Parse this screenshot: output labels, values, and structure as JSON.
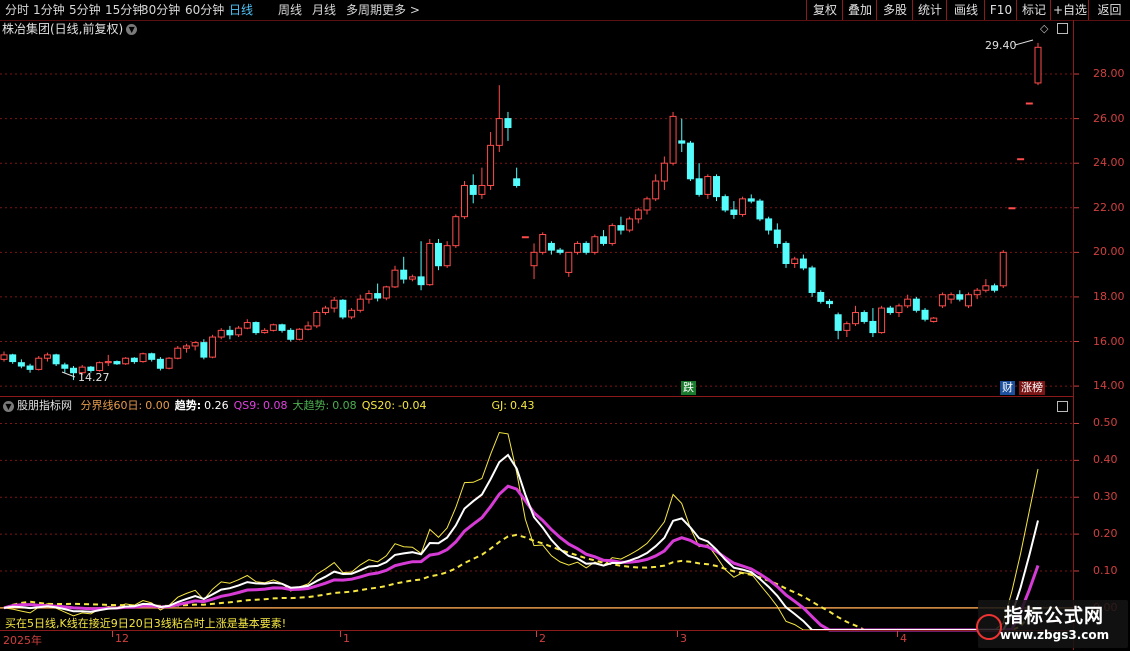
{
  "toolbar": {
    "periods": [
      "分时",
      "1分钟",
      "5分钟",
      "15分钟",
      "30分钟",
      "60分钟",
      "日线",
      "周线",
      "月线",
      "多周期",
      "更多"
    ],
    "active_period": "日线",
    "more_chevron": ">",
    "right_buttons": [
      "复权",
      "叠加",
      "多股",
      "统计",
      "画线",
      "F10",
      "标记",
      "+自选",
      "返回"
    ]
  },
  "stock": {
    "title": "株冶集团(日线,前复权)",
    "dropdown_icon": "chevron-down-icon"
  },
  "price_axis": {
    "labels": [
      "28.00",
      "26.00",
      "24.00",
      "22.00",
      "20.00",
      "18.00",
      "16.00",
      "14.00"
    ],
    "range": [
      13.6,
      30.2
    ]
  },
  "annotations": {
    "high_label": "29.40",
    "low_label": "14.27",
    "badge_die": "跌",
    "badge_cai": "财",
    "badge_zhangting": "涨榜"
  },
  "indicator": {
    "name": "股朋指标网",
    "items": [
      {
        "label": "分界线60日:",
        "value": "0.00",
        "color": "#e69a4c"
      },
      {
        "label": "趋势:",
        "value": "0.26",
        "color": "#ffffff"
      },
      {
        "label": "QS9:",
        "value": "0.08",
        "color": "#e040e0"
      },
      {
        "label": "大趋势:",
        "value": "0.08",
        "color": "#4caf50"
      },
      {
        "label": "QS20:",
        "value": "-0.04",
        "color": "#f5e642"
      },
      {
        "label": "GJ:",
        "value": "0.43",
        "color": "#f5e642"
      }
    ],
    "axis_labels": [
      "0.50",
      "0.40",
      "0.30",
      "0.20",
      "0.10",
      "0.00"
    ],
    "range": [
      -0.06,
      0.55
    ]
  },
  "bottom_note": "买在5日线,K线在接近9日20日3线粘合时上涨是基本要素!",
  "time_axis": {
    "labels": [
      "2025年",
      "12",
      "1",
      "2",
      "3",
      "4"
    ]
  },
  "watermark": {
    "title": "指标公式网",
    "url": "www.zbgs3.com"
  },
  "colors": {
    "up": "#ff4c4c",
    "down": "#54fcfc",
    "grid": "#7a1515",
    "axis": "#d04040"
  },
  "candles": [
    [
      15.2,
      15.55,
      15.1,
      15.4
    ],
    [
      15.4,
      15.45,
      15.0,
      15.1
    ],
    [
      15.05,
      15.2,
      14.8,
      14.9
    ],
    [
      14.9,
      15.0,
      14.6,
      14.75
    ],
    [
      14.75,
      15.35,
      14.7,
      15.25
    ],
    [
      15.25,
      15.5,
      15.1,
      15.4
    ],
    [
      15.4,
      15.45,
      14.9,
      15.0
    ],
    [
      14.95,
      15.05,
      14.6,
      14.8
    ],
    [
      14.8,
      14.9,
      14.27,
      14.6
    ],
    [
      14.6,
      14.95,
      14.5,
      14.85
    ],
    [
      14.85,
      14.9,
      14.6,
      14.7
    ],
    [
      14.7,
      15.1,
      14.65,
      15.05
    ],
    [
      15.05,
      15.4,
      14.9,
      15.1
    ],
    [
      15.1,
      15.15,
      14.95,
      15.0
    ],
    [
      15.0,
      15.3,
      14.95,
      15.25
    ],
    [
      15.25,
      15.3,
      15.0,
      15.1
    ],
    [
      15.1,
      15.5,
      15.05,
      15.45
    ],
    [
      15.45,
      15.5,
      15.1,
      15.2
    ],
    [
      15.2,
      15.3,
      14.7,
      14.8
    ],
    [
      14.8,
      15.3,
      14.75,
      15.25
    ],
    [
      15.25,
      15.8,
      15.2,
      15.7
    ],
    [
      15.7,
      15.9,
      15.5,
      15.8
    ],
    [
      15.8,
      16.0,
      15.6,
      15.95
    ],
    [
      15.95,
      16.1,
      15.2,
      15.3
    ],
    [
      15.3,
      16.3,
      15.25,
      16.2
    ],
    [
      16.2,
      16.6,
      16.1,
      16.5
    ],
    [
      16.5,
      16.7,
      16.1,
      16.3
    ],
    [
      16.3,
      16.7,
      16.2,
      16.6
    ],
    [
      16.6,
      17.0,
      16.55,
      16.85
    ],
    [
      16.85,
      16.9,
      16.3,
      16.4
    ],
    [
      16.4,
      16.6,
      16.35,
      16.5
    ],
    [
      16.5,
      16.8,
      16.45,
      16.75
    ],
    [
      16.75,
      16.8,
      16.4,
      16.5
    ],
    [
      16.5,
      16.6,
      16.0,
      16.1
    ],
    [
      16.1,
      16.6,
      16.05,
      16.55
    ],
    [
      16.55,
      16.9,
      16.5,
      16.7
    ],
    [
      16.7,
      17.4,
      16.6,
      17.3
    ],
    [
      17.3,
      17.6,
      17.2,
      17.5
    ],
    [
      17.5,
      18.0,
      17.3,
      17.85
    ],
    [
      17.85,
      17.9,
      17.0,
      17.1
    ],
    [
      17.1,
      17.5,
      17.0,
      17.4
    ],
    [
      17.4,
      18.1,
      17.3,
      17.9
    ],
    [
      17.9,
      18.3,
      17.7,
      18.15
    ],
    [
      18.15,
      18.6,
      17.8,
      17.95
    ],
    [
      17.95,
      18.5,
      17.85,
      18.45
    ],
    [
      18.45,
      19.4,
      18.4,
      19.2
    ],
    [
      19.2,
      19.8,
      18.6,
      18.8
    ],
    [
      18.8,
      19.0,
      18.7,
      18.9
    ],
    [
      18.9,
      20.5,
      18.3,
      18.55
    ],
    [
      18.55,
      20.6,
      18.5,
      20.4
    ],
    [
      20.4,
      20.6,
      19.2,
      19.4
    ],
    [
      19.4,
      20.5,
      19.3,
      20.3
    ],
    [
      20.3,
      21.7,
      20.2,
      21.6
    ],
    [
      21.6,
      23.2,
      21.5,
      23.0
    ],
    [
      23.0,
      23.5,
      22.2,
      22.6
    ],
    [
      22.6,
      23.8,
      22.4,
      23.0
    ],
    [
      23.0,
      25.4,
      22.8,
      24.8
    ],
    [
      24.8,
      27.5,
      24.5,
      26.0
    ],
    [
      26.0,
      26.3,
      25.0,
      25.6
    ],
    [
      23.3,
      23.8,
      22.9,
      23.0
    ],
    [
      20.7,
      20.7,
      20.7,
      20.7
    ],
    [
      19.4,
      20.4,
      18.8,
      20.0
    ],
    [
      20.0,
      20.9,
      19.9,
      20.8
    ],
    [
      20.4,
      20.5,
      19.9,
      20.1
    ],
    [
      20.1,
      20.2,
      19.9,
      20.0
    ],
    [
      19.1,
      20.0,
      18.9,
      20.0
    ],
    [
      20.0,
      20.5,
      19.9,
      20.4
    ],
    [
      20.4,
      20.5,
      19.9,
      20.0
    ],
    [
      20.0,
      20.8,
      19.9,
      20.7
    ],
    [
      20.7,
      21.0,
      20.3,
      20.4
    ],
    [
      20.4,
      21.3,
      20.3,
      21.2
    ],
    [
      21.2,
      21.6,
      20.8,
      21.0
    ],
    [
      21.0,
      21.6,
      20.9,
      21.5
    ],
    [
      21.5,
      22.0,
      21.3,
      21.9
    ],
    [
      21.9,
      22.5,
      21.7,
      22.4
    ],
    [
      22.4,
      23.5,
      22.3,
      23.2
    ],
    [
      23.2,
      24.3,
      22.8,
      24.0
    ],
    [
      24.0,
      26.3,
      23.9,
      26.1
    ],
    [
      25.0,
      26.0,
      24.5,
      24.9
    ],
    [
      24.9,
      25.0,
      23.2,
      23.3
    ],
    [
      23.3,
      24.0,
      22.5,
      22.6
    ],
    [
      22.6,
      23.5,
      22.4,
      23.4
    ],
    [
      23.4,
      23.5,
      22.3,
      22.5
    ],
    [
      22.5,
      22.6,
      21.8,
      21.9
    ],
    [
      21.9,
      22.3,
      21.5,
      21.7
    ],
    [
      21.7,
      22.5,
      21.6,
      22.4
    ],
    [
      22.4,
      22.6,
      22.2,
      22.3
    ],
    [
      22.3,
      22.4,
      21.4,
      21.5
    ],
    [
      21.5,
      21.6,
      20.8,
      21.0
    ],
    [
      21.0,
      21.3,
      20.2,
      20.4
    ],
    [
      20.4,
      20.5,
      19.3,
      19.5
    ],
    [
      19.5,
      19.8,
      19.3,
      19.7
    ],
    [
      19.7,
      19.9,
      19.2,
      19.3
    ],
    [
      19.3,
      19.4,
      18.0,
      18.2
    ],
    [
      18.2,
      18.3,
      17.7,
      17.8
    ],
    [
      17.8,
      17.9,
      17.5,
      17.7
    ],
    [
      17.2,
      17.3,
      16.1,
      16.5
    ],
    [
      16.5,
      16.9,
      16.2,
      16.8
    ],
    [
      16.8,
      17.6,
      16.7,
      17.3
    ],
    [
      17.3,
      17.4,
      16.8,
      16.9
    ],
    [
      16.9,
      17.5,
      16.2,
      16.4
    ],
    [
      16.4,
      17.6,
      16.35,
      17.5
    ],
    [
      17.5,
      17.6,
      17.2,
      17.3
    ],
    [
      17.3,
      17.7,
      17.1,
      17.6
    ],
    [
      17.6,
      18.1,
      17.5,
      17.9
    ],
    [
      17.9,
      18.0,
      17.3,
      17.4
    ],
    [
      17.4,
      17.5,
      16.9,
      17.0
    ],
    [
      16.9,
      17.1,
      16.85,
      17.05
    ],
    [
      17.6,
      18.2,
      17.5,
      18.1
    ],
    [
      17.9,
      18.2,
      17.7,
      18.1
    ],
    [
      18.1,
      18.3,
      17.8,
      17.9
    ],
    [
      17.6,
      18.2,
      17.5,
      18.1
    ],
    [
      18.1,
      18.4,
      17.9,
      18.3
    ],
    [
      18.3,
      18.8,
      18.2,
      18.5
    ],
    [
      18.5,
      18.6,
      18.2,
      18.3
    ],
    [
      18.5,
      20.1,
      18.4,
      20.0
    ],
    [
      22.0,
      22.0,
      22.0,
      22.0
    ],
    [
      24.2,
      24.2,
      24.2,
      24.2
    ],
    [
      26.7,
      26.7,
      26.7,
      26.7
    ],
    [
      27.6,
      29.4,
      27.5,
      29.2
    ]
  ]
}
